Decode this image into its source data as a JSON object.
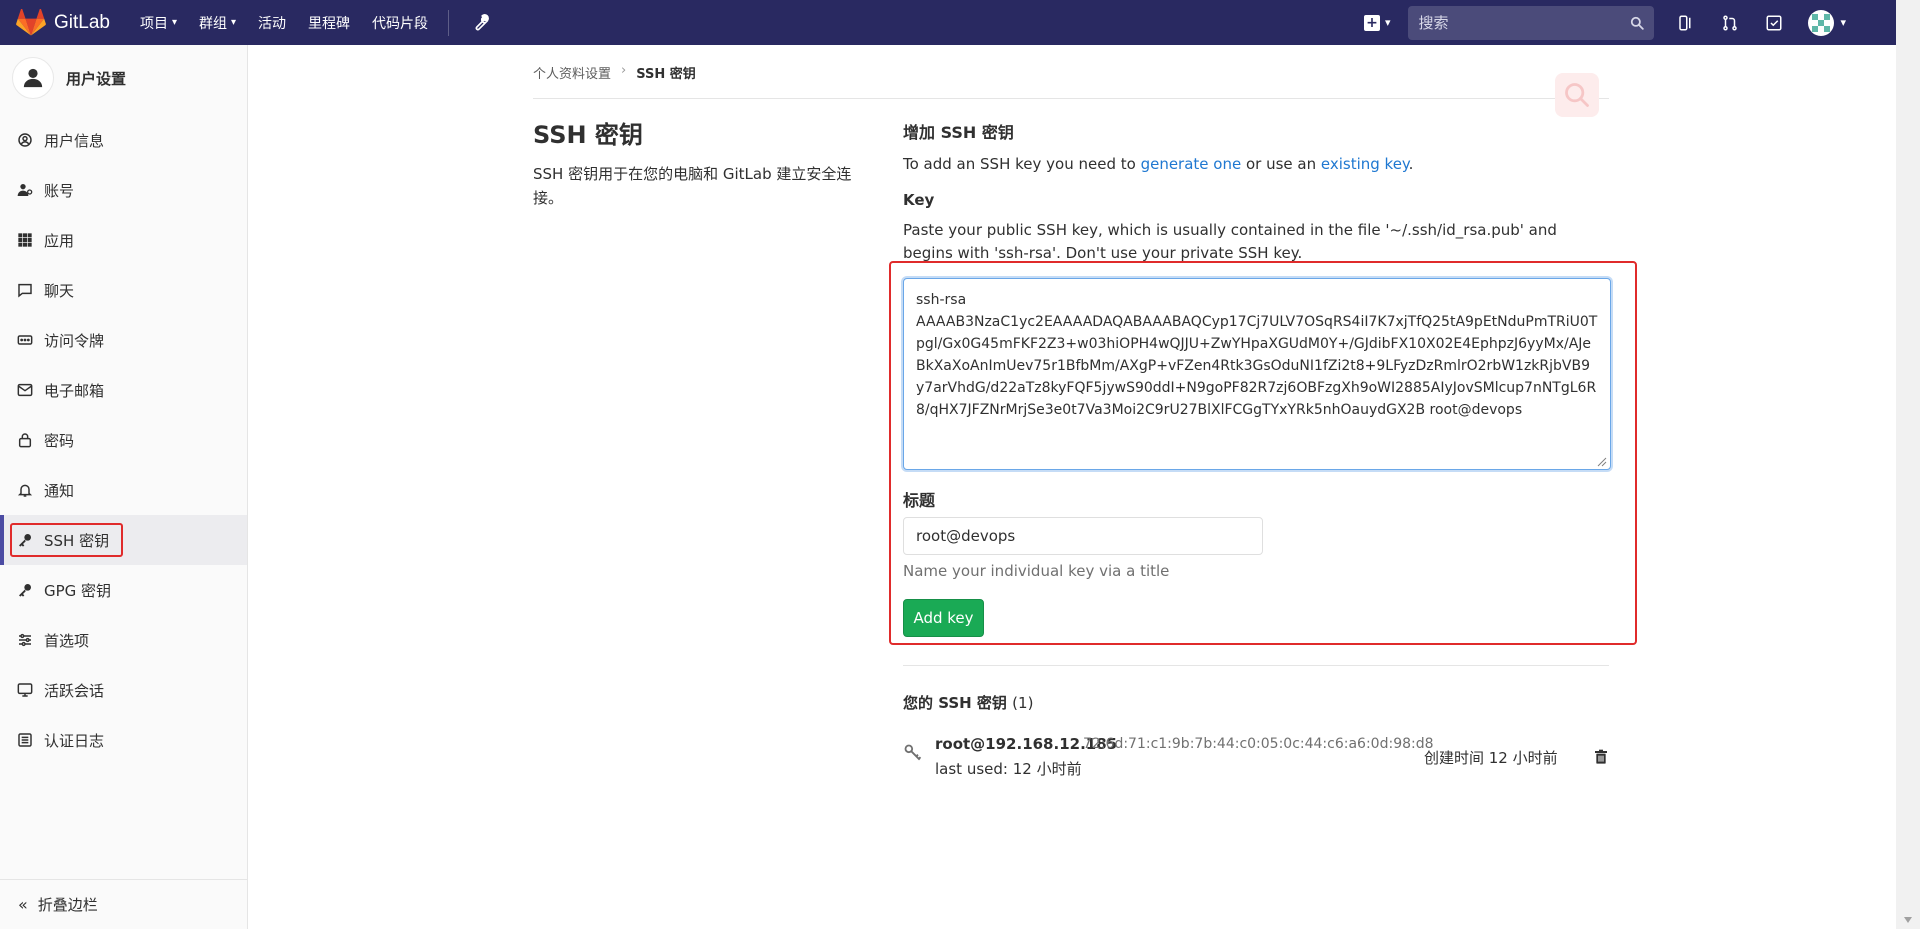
{
  "topbar": {
    "brand": "GitLab",
    "nav": [
      {
        "label": "项目",
        "caret": "▾"
      },
      {
        "label": "群组",
        "caret": "▾"
      },
      {
        "label": "活动"
      },
      {
        "label": "里程碑"
      },
      {
        "label": "代码片段"
      }
    ],
    "search_placeholder": "搜索",
    "plus_label": "+",
    "caret": "▾"
  },
  "sidebar": {
    "title": "用户设置",
    "items": [
      {
        "label": "用户信息",
        "icon": "profile-icon"
      },
      {
        "label": "账号",
        "icon": "account-icon"
      },
      {
        "label": "应用",
        "icon": "apps-icon"
      },
      {
        "label": "聊天",
        "icon": "chat-icon"
      },
      {
        "label": "访问令牌",
        "icon": "token-icon"
      },
      {
        "label": "电子邮箱",
        "icon": "mail-icon"
      },
      {
        "label": "密码",
        "icon": "lock-icon"
      },
      {
        "label": "通知",
        "icon": "bell-icon"
      },
      {
        "label": "SSH 密钥",
        "icon": "key-icon",
        "active": true
      },
      {
        "label": "GPG 密钥",
        "icon": "key-icon"
      },
      {
        "label": "首选项",
        "icon": "sliders-icon"
      },
      {
        "label": "活跃会话",
        "icon": "monitor-icon"
      },
      {
        "label": "认证日志",
        "icon": "log-icon"
      }
    ],
    "collapse_label": "折叠边栏",
    "collapse_glyph": "«"
  },
  "breadcrumb": {
    "parent": "个人资料设置",
    "separator": "›",
    "current": "SSH 密钥"
  },
  "intro": {
    "title": "SSH 密钥",
    "description": "SSH 密钥用于在您的电脑和 GitLab 建立安全连接。"
  },
  "form": {
    "heading": "增加 SSH 密钥",
    "desc_prefix": "To add an SSH key you need to ",
    "generate_link": "generate one",
    "desc_middle": " or use an ",
    "existing_link": "existing key",
    "desc_suffix": ".",
    "key_label": "Key",
    "key_help": "Paste your public SSH key, which is usually contained in the file '~/.ssh/id_rsa.pub' and begins with 'ssh-rsa'. Don't use your private SSH key.",
    "key_value": "ssh-rsa\nAAAAB3NzaC1yc2EAAAADAQABAAABAQCyp17Cj7ULV7OSqRS4iI7K7xjTfQ25tA9pEtNduPmTRiU0Tpgl/Gx0G45mFKF2Z3+w03hiOPH4wQJJU+ZwYHpaXGUdM0Y+/GJdibFX10X02E4EphpzJ6yyMx/AJeBkXaXoAnImUev75r1BfbMm/AXgP+vFZen4Rtk3GsOduNI1fZi2t8+9LFyzDzRmlrO2rbW1zkRjbVB9y7arVhdG/d22aTz8kyFQF5jywS90ddI+N9goPF82R7zj6OBFzgXh9oWI2885AIyJovSMlcup7nNTgL6R8/qHX7JFZNrMrjSe3e0t7Va3Moi2C9rU27BlXlFCGgTYxYRk5nhOauydGX2B root@devops",
    "title_label": "标题",
    "title_value": "root@devops",
    "title_help": "Name your individual key via a title",
    "add_button": "Add key"
  },
  "keys": {
    "heading": "您的 SSH 密钥",
    "count": "(1)",
    "items": [
      {
        "name": "root@192.168.12.185",
        "fingerprint": "72:6d:71:c1:9b:7b:44:c0:05:0c:44:c6:a6:0d:98:d8",
        "last_used": "last used: 12 小时前",
        "created": "创建时间 12 小时前"
      }
    ]
  },
  "colors": {
    "navbar": "#292961",
    "accent_link": "#1f78d1",
    "add_button": "#1aaa55",
    "highlight": "#e02b2b",
    "active_bar": "#4b4ba3"
  }
}
